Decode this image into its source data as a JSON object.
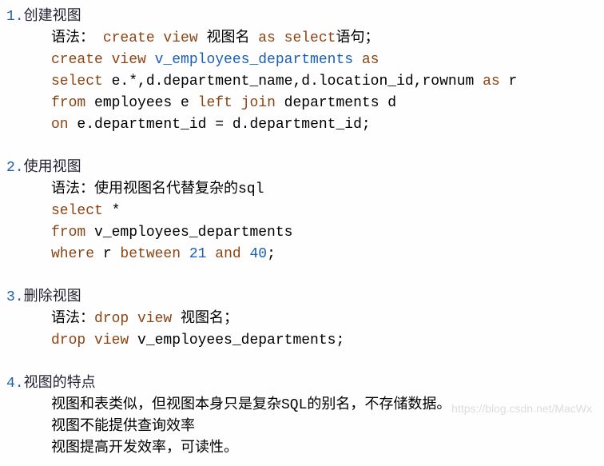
{
  "sections": {
    "s1": {
      "num": "1.",
      "title": "创建视图",
      "syntax_label": "语法： ",
      "syntax_kw1": "create view",
      "syntax_txt1": " 视图名 ",
      "syntax_kw2": "as select",
      "syntax_txt2": "语句；",
      "l1_kw1": "create view",
      "l1_id1": " v_employees_departments ",
      "l1_kw2": "as",
      "l2_kw1": "select",
      "l2_txt1": " e.",
      "l2_sym1": "*",
      "l2_txt2": ",d.department_name,d.location_id,rownum ",
      "l2_kw2": "as",
      "l2_txt3": " r",
      "l3_kw1": "from",
      "l3_txt1": " employees e ",
      "l3_kw2": "left join",
      "l3_txt2": " departments d",
      "l4_kw1": "on",
      "l4_txt1": " e.department_id ",
      "l4_sym1": "=",
      "l4_txt2": " d.department_id;"
    },
    "s2": {
      "num": "2.",
      "title": "使用视图",
      "syntax_label": "语法：使用视图名代替复杂的sql",
      "l1_kw1": "select",
      "l1_sym1": " *",
      "l2_kw1": "from",
      "l2_txt1": " v_employees_departments",
      "l3_kw1": "where",
      "l3_txt1": " r ",
      "l3_kw2": "between",
      "l3_num1": " 21 ",
      "l3_kw3": "and",
      "l3_num2": " 40",
      "l3_txt2": ";"
    },
    "s3": {
      "num": "3.",
      "title": "删除视图",
      "syntax_label": "语法：",
      "syntax_kw1": "drop view",
      "syntax_txt1": " 视图名；",
      "l1_kw1": "drop view",
      "l1_txt1": " v_employees_departments;"
    },
    "s4": {
      "num": "4.",
      "title": "视图的特点",
      "p1": "视图和表类似，但视图本身只是复杂SQL的别名，不存储数据。",
      "p2": "视图不能提供查询效率",
      "p3": "视图提高开发效率，可读性。"
    }
  },
  "watermark": "https://blog.csdn.net/MacWx"
}
